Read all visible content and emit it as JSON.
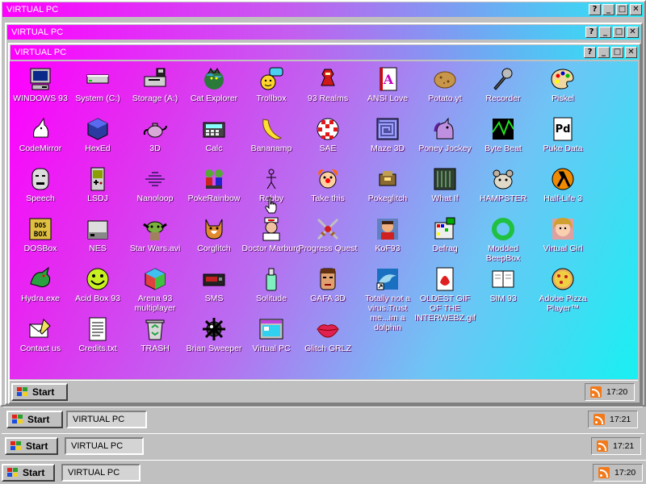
{
  "windows": [
    {
      "title": "VIRTUAL PC"
    },
    {
      "title": "VIRTUAL PC"
    },
    {
      "title": "VIRTUAL PC"
    }
  ],
  "title_buttons": {
    "help": "?",
    "minimize": "_",
    "maximize": "□",
    "close": "✕"
  },
  "desktop_icons": [
    {
      "label": "WINDOWS 93",
      "icon": "computer-icon"
    },
    {
      "label": "System (C:)",
      "icon": "drive-icon"
    },
    {
      "label": "Storage (A:)",
      "icon": "floppy-drive-icon"
    },
    {
      "label": "Cat Explorer",
      "icon": "cat-globe-icon"
    },
    {
      "label": "Trollbox",
      "icon": "chat-face-icon"
    },
    {
      "label": "93 Realms",
      "icon": "knight-icon"
    },
    {
      "label": "ANSI Love",
      "icon": "ansi-document-icon"
    },
    {
      "label": "Potato.yt",
      "icon": "potato-icon"
    },
    {
      "label": "Recorder",
      "icon": "microphone-icon"
    },
    {
      "label": "Piskel",
      "icon": "palette-icon"
    },
    {
      "label": "CodeMirror",
      "icon": "unicorn-icon"
    },
    {
      "label": "HexEd",
      "icon": "hex-cube-icon"
    },
    {
      "label": "3D",
      "icon": "teapot-icon"
    },
    {
      "label": "Calc",
      "icon": "calculator-icon"
    },
    {
      "label": "Bananamp",
      "icon": "banana-icon"
    },
    {
      "label": "SAE",
      "icon": "ball-icon"
    },
    {
      "label": "Maze 3D",
      "icon": "maze-icon"
    },
    {
      "label": "Poney Jockey",
      "icon": "pony-icon"
    },
    {
      "label": "Byte Beat",
      "icon": "bytebeat-icon"
    },
    {
      "label": "Puke Data",
      "icon": "puke-data-icon"
    },
    {
      "label": "Speech",
      "icon": "speech-face-icon"
    },
    {
      "label": "LSDJ",
      "icon": "gameboy-icon"
    },
    {
      "label": "Nanoloop",
      "icon": "wave-icon"
    },
    {
      "label": "PokeRainbow",
      "icon": "trainers-icon"
    },
    {
      "label": "Robby",
      "icon": "stick-figure-icon"
    },
    {
      "label": "Take this",
      "icon": "clown-icon"
    },
    {
      "label": "Pokeglitch",
      "icon": "pokeglitch-icon"
    },
    {
      "label": "What If",
      "icon": "what-if-icon"
    },
    {
      "label": "HAMPSTER",
      "icon": "hamster-icon"
    },
    {
      "label": "Half-Life 3",
      "icon": "lambda-icon"
    },
    {
      "label": "DOSBox",
      "icon": "dosbox-icon"
    },
    {
      "label": "NES",
      "icon": "nes-icon"
    },
    {
      "label": "Star Wars.avi",
      "icon": "yoda-icon"
    },
    {
      "label": "Corglitch",
      "icon": "corgi-icon"
    },
    {
      "label": "Doctor Marburg",
      "icon": "doctor-icon"
    },
    {
      "label": "Progress Quest",
      "icon": "swords-icon"
    },
    {
      "label": "KoF93",
      "icon": "fighter-icon"
    },
    {
      "label": "Defrag",
      "icon": "defrag-icon"
    },
    {
      "label": "Modded BeepBox",
      "icon": "ring-icon"
    },
    {
      "label": "Virtual Girl",
      "icon": "girl-face-icon"
    },
    {
      "label": "Hydra.exe",
      "icon": "dragon-icon"
    },
    {
      "label": "Acid Box 93",
      "icon": "smiley-icon"
    },
    {
      "label": "Arena 93 multiplayer",
      "icon": "arena-cube-icon"
    },
    {
      "label": "SMS",
      "icon": "console-icon"
    },
    {
      "label": "Solitude",
      "icon": "bottle-icon"
    },
    {
      "label": "GAFA 3D",
      "icon": "man-face-icon"
    },
    {
      "label": "Totally not a virus.Trust me...im a dolphin",
      "icon": "dolphin-icon"
    },
    {
      "label": "OLDEST GIF OF THE INTERWEBZ.gif",
      "icon": "gif-file-icon"
    },
    {
      "label": "SIM 93",
      "icon": "book-icon"
    },
    {
      "label": "Adobe Pizza Player™",
      "icon": "pizza-icon"
    },
    {
      "label": "Contact us",
      "icon": "mail-icon"
    },
    {
      "label": "Credits.txt",
      "icon": "text-file-icon"
    },
    {
      "label": "TRASH",
      "icon": "recycle-bin-icon"
    },
    {
      "label": "Brian Sweeper",
      "icon": "mine-icon"
    },
    {
      "label": "Virtual PC",
      "icon": "virtual-pc-icon"
    },
    {
      "label": "Glitch GRLZ",
      "icon": "lips-icon"
    }
  ],
  "taskbars": [
    {
      "start": "Start",
      "task": "",
      "time": "17:20"
    },
    {
      "start": "Start",
      "task": "VIRTUAL PC",
      "time": "17:21"
    },
    {
      "start": "Start",
      "task": "VIRTUAL PC",
      "time": "17:21"
    },
    {
      "start": "Start",
      "task": "VIRTUAL PC",
      "time": "17:20"
    }
  ]
}
